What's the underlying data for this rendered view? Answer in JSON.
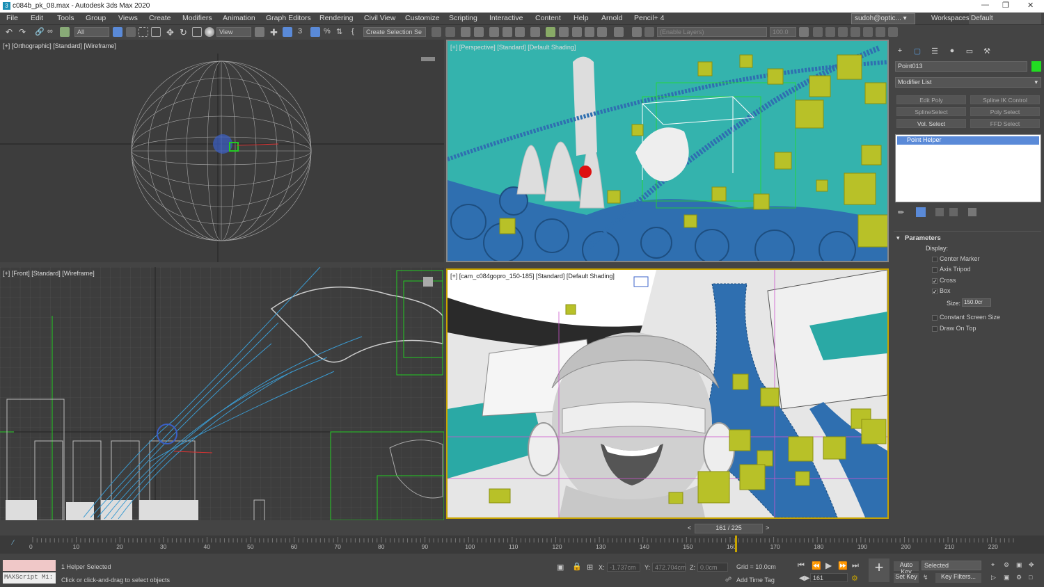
{
  "window": {
    "title": "c084b_pk_08.max - Autodesk 3ds Max 2020",
    "app_icon": "3ds-max-icon"
  },
  "menu": [
    "File",
    "Edit",
    "Tools",
    "Group",
    "Views",
    "Create",
    "Modifiers",
    "Animation",
    "Graph Editors",
    "Rendering",
    "Civil View",
    "Customize",
    "Scripting",
    "Interactive",
    "Content",
    "Help",
    "Arnold",
    "Pencil+ 4"
  ],
  "user": {
    "name": "sudoh@optic...",
    "workspaces_label": "Workspaces:",
    "workspace": "Default"
  },
  "toolbar": {
    "selection_filter": "All",
    "ref_coord": "View",
    "named_selection": "Create Selection Se",
    "layer": "(Enable Layers)",
    "percent": "100.0"
  },
  "viewports": {
    "top_left": {
      "label": "[+] [Orthographic] [Standard] [Wireframe]"
    },
    "top_right": {
      "label": "[+] [Perspective] [Standard] [Default Shading]"
    },
    "bottom_left": {
      "label": "[+] [Front] [Standard] [Wireframe]"
    },
    "bottom_right": {
      "label": "[+] [cam_c084gopro_150-185] [Standard] [Default Shading]"
    }
  },
  "command_panel": {
    "object_name": "Point013",
    "object_color": "#22dd22",
    "modifier_list": "Modifier List",
    "mod_buttons": [
      "Edit Poly",
      "Spline IK Control",
      "SplineSelect",
      "Poly Select",
      "Vol. Select",
      "FFD Select"
    ],
    "stack_item": "Point Helper",
    "rollout": "Parameters",
    "display_label": "Display:",
    "options": [
      {
        "label": "Center Marker",
        "checked": false
      },
      {
        "label": "Axis Tripod",
        "checked": false
      },
      {
        "label": "Cross",
        "checked": true
      },
      {
        "label": "Box",
        "checked": true
      }
    ],
    "size_label": "Size:",
    "size_value": "150.0cr",
    "options2": [
      {
        "label": "Constant Screen Size",
        "checked": false
      },
      {
        "label": "Draw On Top",
        "checked": false
      }
    ]
  },
  "time": {
    "frame_display": "161 / 225",
    "current": 161,
    "total": 225,
    "ticks": [
      "0",
      "10",
      "20",
      "30",
      "40",
      "50",
      "60",
      "70",
      "80",
      "90",
      "100",
      "110",
      "120",
      "130",
      "140",
      "150",
      "160",
      "170",
      "180",
      "190",
      "200",
      "210",
      "220"
    ]
  },
  "status": {
    "maxscript": "MAXScript Mi:",
    "selected": "1 Helper Selected",
    "prompt": "Click or click-and-drag to select objects",
    "x_label": "X:",
    "x": "-1.737cm",
    "y_label": "Y:",
    "y": "472.704cm",
    "z_label": "Z:",
    "z": "0.0cm",
    "grid": "Grid = 10.0cm",
    "add_time_tag": "Add Time Tag",
    "frame": "161",
    "auto_key": "Auto Key",
    "set_key": "Set Key",
    "key_mode": "Selected",
    "key_filters": "Key Filters..."
  }
}
